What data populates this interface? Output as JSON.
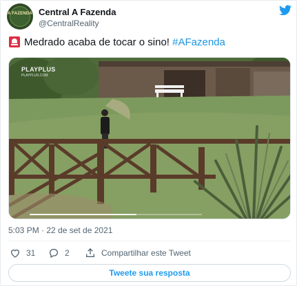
{
  "author": {
    "name": "Central A Fazenda",
    "handle": "@CentralReality",
    "avatar_text": "A FAZENDA",
    "avatar_icon": "a-fazenda-logo"
  },
  "brand_icon": "twitter-bird-icon",
  "tweet": {
    "emoji_icon": "bell-emoji",
    "text": "Medrado acaba de tocar o sino!",
    "hashtag": "#AFazenda"
  },
  "media": {
    "overlay_logo": "PLAYPLUS",
    "overlay_sub": "PLAYPLUS.COM",
    "progress": 0.62
  },
  "timestamp": "5:03 PM · 22 de set de 2021",
  "actions": {
    "likes": "31",
    "replies": "2",
    "share_label": "Compartilhar este Tweet"
  },
  "reply_button_label": "Tweete sua resposta",
  "colors": {
    "accent": "#1d9bf0",
    "hashtag": "#1b95e0",
    "secondary_text": "#536471"
  }
}
